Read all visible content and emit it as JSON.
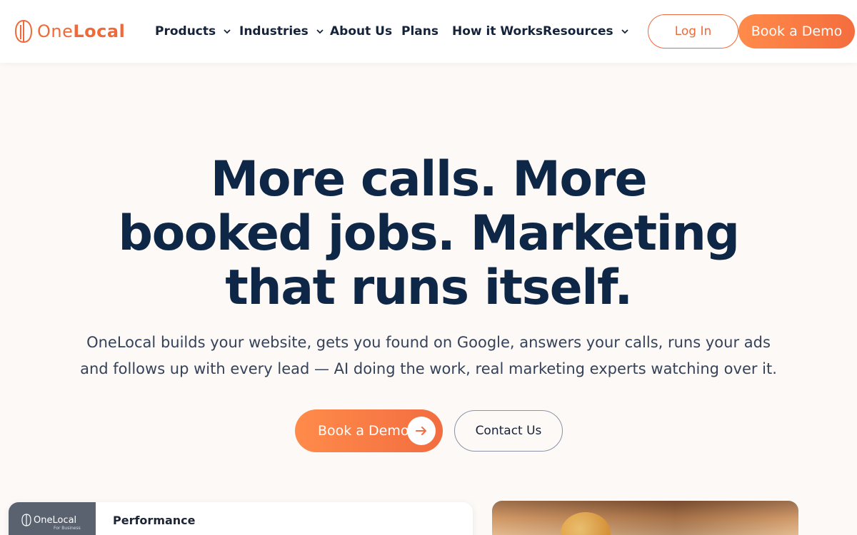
{
  "brand": {
    "name_one": "One",
    "name_local": "Local",
    "accent": "#ef6a3a",
    "navy": "#0e2747"
  },
  "nav": {
    "items": [
      {
        "label": "Products",
        "has_dropdown": true
      },
      {
        "label": "Industries",
        "has_dropdown": true
      },
      {
        "label": "About Us",
        "has_dropdown": false
      },
      {
        "label": "Plans",
        "has_dropdown": false
      },
      {
        "label": "How it Works",
        "has_dropdown": false
      },
      {
        "label": "Resources",
        "has_dropdown": true
      }
    ],
    "login_label": "Log In",
    "demo_label": "Book a Demo"
  },
  "hero": {
    "title": "More calls. More booked jobs. Marketing that runs itself.",
    "subtitle": "OneLocal builds your website, gets you found on Google, answers your calls, runs your ads and follows up with every lead — AI doing the work, real marketing experts watching over it.",
    "primary_cta": "Book a Demo",
    "secondary_cta": "Contact Us"
  },
  "dashboard_preview": {
    "logo_text": "OneLocal",
    "logo_sub": "For Business",
    "title": "Performance"
  }
}
